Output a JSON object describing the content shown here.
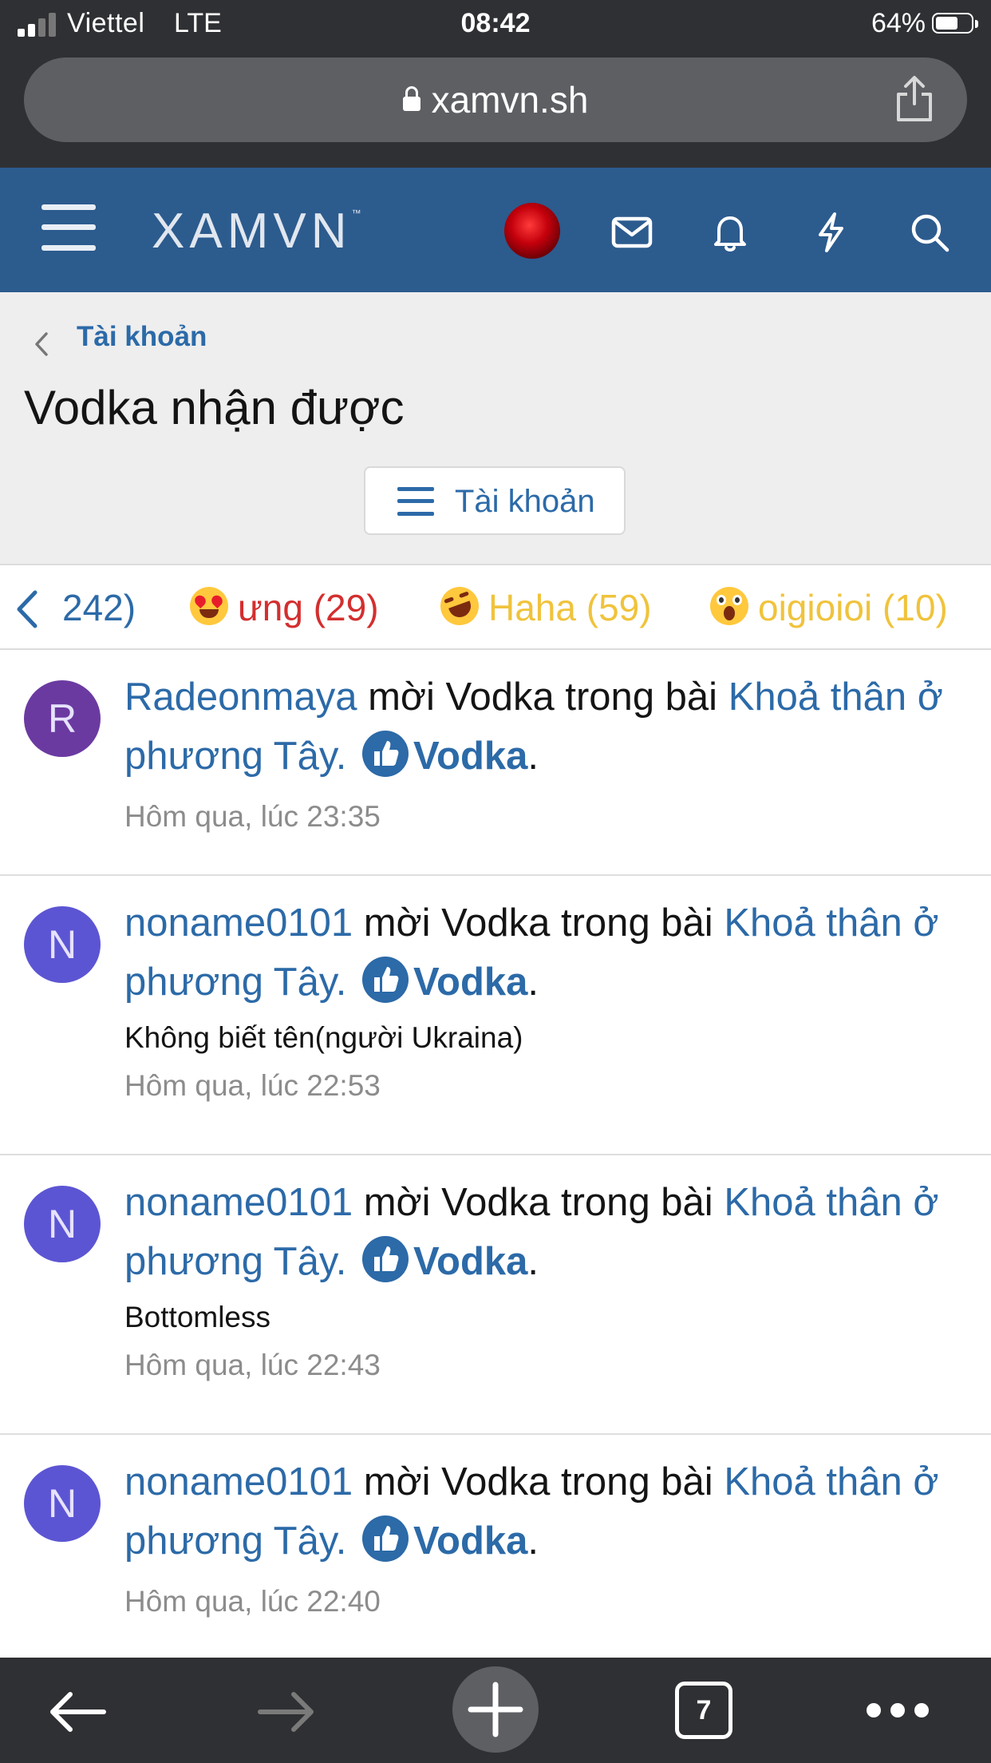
{
  "status_bar": {
    "carrier": "Viettel",
    "network": "LTE",
    "time": "08:42",
    "battery": "64%",
    "battery_level": 0.64
  },
  "browser": {
    "url": "xamvn.sh",
    "tabs_count": "7"
  },
  "site": {
    "logo": "XAMVN",
    "logo_tm": "™"
  },
  "breadcrumb": {
    "label": "Tài khoản"
  },
  "page": {
    "title": "Vodka nhận được",
    "account_button": "Tài khoản"
  },
  "reaction_tabs": [
    {
      "label": "242)",
      "color": "#2c6aa8"
    },
    {
      "label": "ưng (29)",
      "color": "#d32f2f",
      "emoji": "heart-eyes-emoji-icon"
    },
    {
      "label": "Haha (59)",
      "color": "#f0c33c",
      "emoji": "laughing-emoji-icon"
    },
    {
      "label": "oigioioi (10)",
      "color": "#f0c33c",
      "emoji": "wow-emoji-icon"
    }
  ],
  "alerts": [
    {
      "initial": "R",
      "avatar_color": "#6b3aa1",
      "user": "Radeonmaya",
      "action": " mời Vodka trong bài ",
      "thread": "Khoả thân ở phương Tây.",
      "reactor": "Vodka",
      "snippet": "",
      "time": "Hôm qua, lúc 23:35"
    },
    {
      "initial": "N",
      "avatar_color": "#5c55d3",
      "user": "noname0101",
      "action": " mời Vodka trong bài ",
      "thread": "Khoả thân ở phương Tây.",
      "reactor": "Vodka",
      "snippet": "Không biết tên(người Ukraina)",
      "time": "Hôm qua, lúc 22:53"
    },
    {
      "initial": "N",
      "avatar_color": "#5c55d3",
      "user": "noname0101",
      "action": " mời Vodka trong bài ",
      "thread": "Khoả thân ở phương Tây.",
      "reactor": "Vodka",
      "snippet": "Bottomless",
      "time": "Hôm qua, lúc 22:43"
    },
    {
      "initial": "N",
      "avatar_color": "#5c55d3",
      "user": "noname0101",
      "action": " mời Vodka trong bài ",
      "thread": "Khoả thân ở phương Tây.",
      "reactor": "Vodka",
      "snippet": "",
      "time": "Hôm qua, lúc 22:40"
    }
  ],
  "colors": {
    "header": "#2c5b8e",
    "link": "#2c6aa8",
    "page_head_bg": "#eeeeee",
    "browser_chrome": "#2f3033"
  }
}
